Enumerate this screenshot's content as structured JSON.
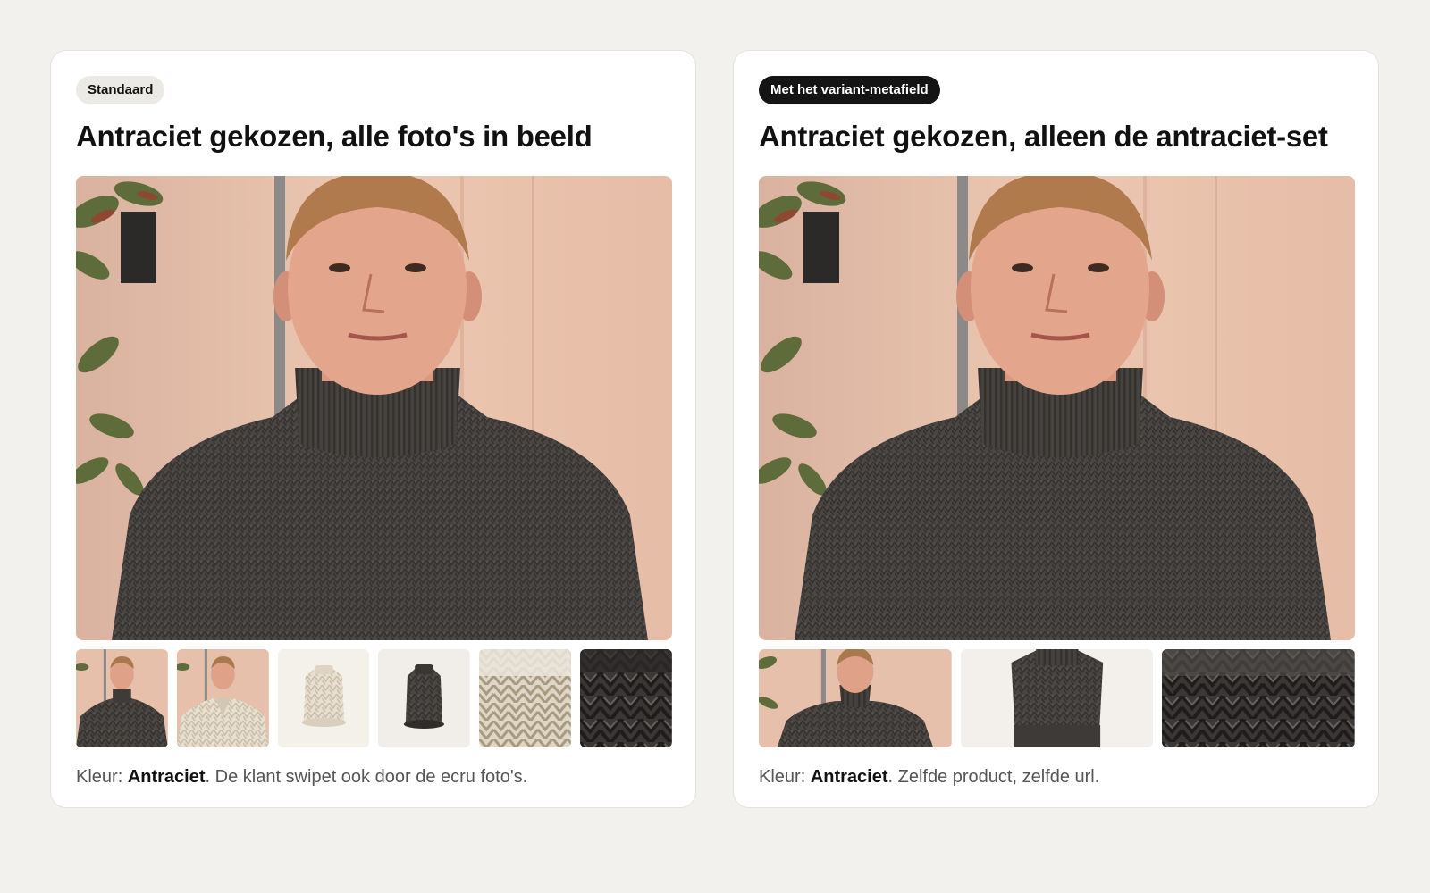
{
  "colors": {
    "page_bg": "#f2f1ed",
    "card_bg": "#ffffff",
    "badge_light": "#eceae4",
    "badge_dark": "#141414",
    "sweater_antraciet": "#4a4643",
    "sweater_ecru": "#e7e0d2",
    "wall": "#e8c3ad"
  },
  "panels": [
    {
      "badge": "Standaard",
      "title": "Antraciet gekozen, alle foto's in beeld",
      "thumbnails": [
        {
          "name": "model-antraciet",
          "icon": "model-antraciet-photo"
        },
        {
          "name": "model-ecru",
          "icon": "model-ecru-photo"
        },
        {
          "name": "product-ecru",
          "icon": "sweater-ecru-photo"
        },
        {
          "name": "product-antraciet",
          "icon": "sweater-antraciet-photo"
        },
        {
          "name": "detail-ecru",
          "icon": "knit-ecru-photo"
        },
        {
          "name": "detail-antraciet",
          "icon": "knit-antraciet-photo"
        }
      ],
      "caption": {
        "prefix": "Kleur: ",
        "color": "Antraciet",
        "suffix": ". De klant swipet ook door de ecru foto's."
      }
    },
    {
      "badge": "Met het variant-metafield",
      "title": "Antraciet gekozen, alleen de antraciet-set",
      "thumbnails": [
        {
          "name": "model-antraciet",
          "icon": "model-antraciet-photo"
        },
        {
          "name": "product-antraciet",
          "icon": "sweater-antraciet-photo"
        },
        {
          "name": "detail-antraciet",
          "icon": "knit-antraciet-photo"
        }
      ],
      "caption": {
        "prefix": "Kleur: ",
        "color": "Antraciet",
        "suffix": ". Zelfde product, zelfde url."
      }
    }
  ]
}
